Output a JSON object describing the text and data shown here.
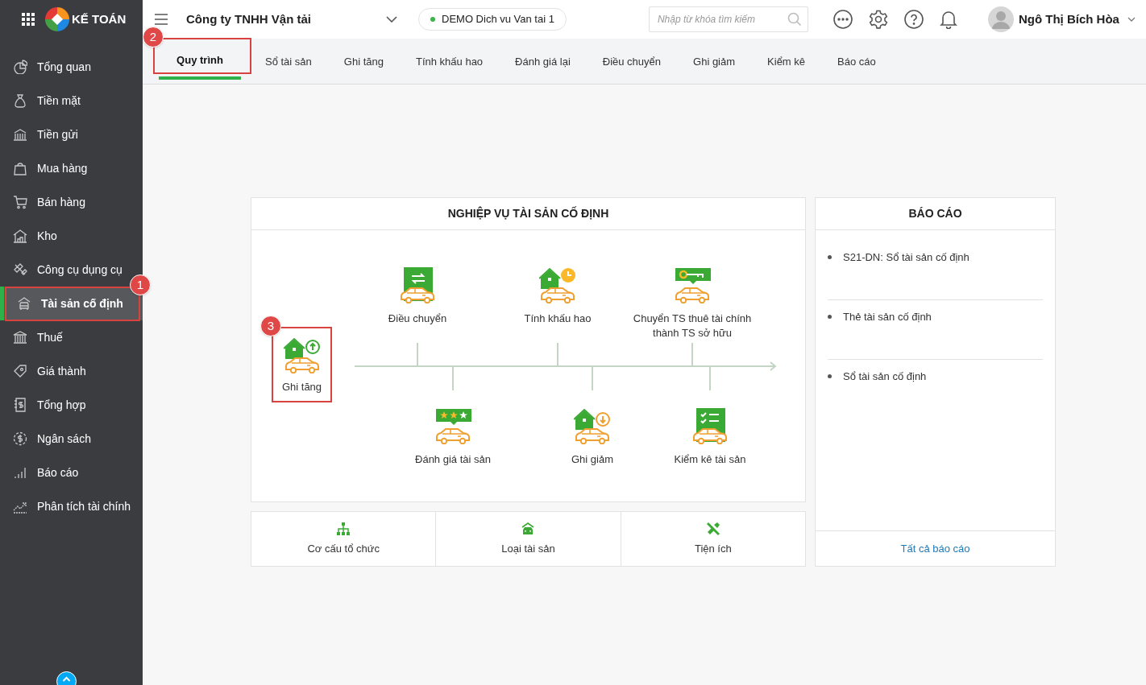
{
  "app": {
    "logo_text": "KẾ TOÁN"
  },
  "sidebar": {
    "items": [
      {
        "label": "Tổng quan",
        "selected": false
      },
      {
        "label": "Tiền mặt",
        "selected": false
      },
      {
        "label": "Tiền gửi",
        "selected": false
      },
      {
        "label": "Mua hàng",
        "selected": false
      },
      {
        "label": "Bán hàng",
        "selected": false
      },
      {
        "label": "Kho",
        "selected": false
      },
      {
        "label": "Công cụ dụng cụ",
        "selected": false
      },
      {
        "label": "Tài sản cố định",
        "selected": true,
        "callout": "1"
      },
      {
        "label": "Thuế",
        "selected": false
      },
      {
        "label": "Giá thành",
        "selected": false
      },
      {
        "label": "Tổng hợp",
        "selected": false
      },
      {
        "label": "Ngân sách",
        "selected": false
      },
      {
        "label": "Báo cáo",
        "selected": false
      },
      {
        "label": "Phân tích tài chính",
        "selected": false
      }
    ]
  },
  "header": {
    "company": "Công ty TNHH Vận tải",
    "database": "DEMO Dich vu Van tai 1",
    "search": {
      "placeholder": "Nhập từ khóa tìm kiếm"
    },
    "user": "Ngô Thị Bích Hòa"
  },
  "tabs": [
    {
      "label": "Quy trình",
      "selected": true,
      "callout": "2"
    },
    {
      "label": "Sổ tài sản",
      "selected": false
    },
    {
      "label": "Ghi tăng",
      "selected": false
    },
    {
      "label": "Tính khấu hao",
      "selected": false
    },
    {
      "label": "Đánh giá lại",
      "selected": false
    },
    {
      "label": "Điều chuyển",
      "selected": false
    },
    {
      "label": "Ghi giảm",
      "selected": false
    },
    {
      "label": "Kiểm kê",
      "selected": false
    },
    {
      "label": "Báo cáo",
      "selected": false
    }
  ],
  "process_card": {
    "title": "NGHIỆP VỤ TÀI SẢN CỐ ĐỊNH",
    "steps": [
      {
        "label": "Ghi tăng",
        "kind": "start",
        "highlighted": true,
        "callout": "3"
      },
      {
        "label": "Điều chuyển",
        "kind": "top",
        "highlighted": false
      },
      {
        "label": "Tính khấu hao",
        "kind": "top",
        "highlighted": false
      },
      {
        "label": "Chuyển TS thuê tài chính thành TS sở hữu",
        "kind": "top",
        "highlighted": false
      },
      {
        "label": "Đánh giá tài sản",
        "kind": "bottom",
        "highlighted": false
      },
      {
        "label": "Ghi giảm",
        "kind": "bottom",
        "highlighted": false
      },
      {
        "label": "Kiểm kê tài sản",
        "kind": "bottom",
        "highlighted": false
      }
    ]
  },
  "shortcuts": [
    {
      "label": "Cơ cấu tổ chức"
    },
    {
      "label": "Loại tài sản"
    },
    {
      "label": "Tiện ích"
    }
  ],
  "report_card": {
    "title": "BÁO CÁO",
    "items": [
      "S21-DN: Sổ tài sản cố định",
      "Thẻ tài sản cố định",
      "Sổ tài sản cố định"
    ],
    "link": "Tất cả báo cáo"
  }
}
